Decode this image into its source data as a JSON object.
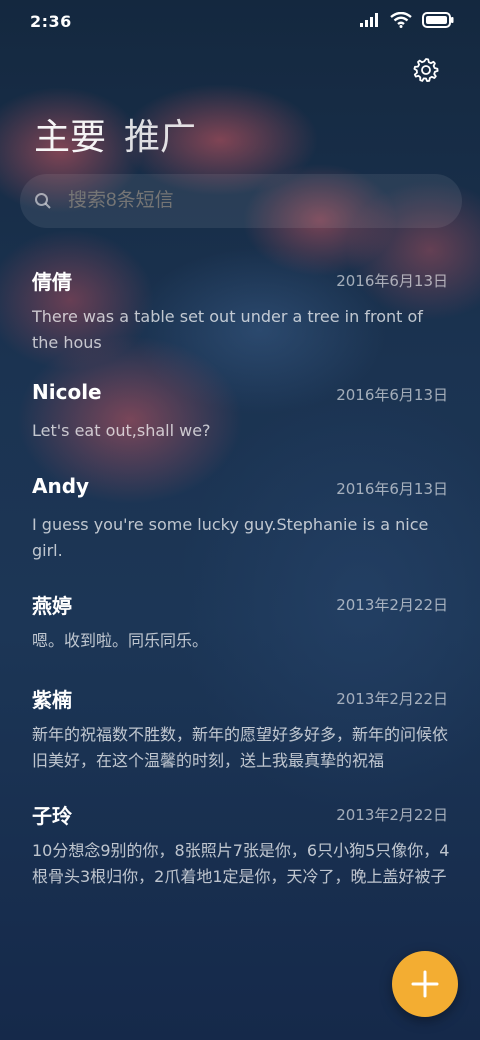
{
  "status_bar": {
    "time": "2:36",
    "icons": [
      "signal-icon",
      "wifi-icon",
      "battery-icon"
    ]
  },
  "header": {
    "settings_icon": "gear-icon",
    "tabs": [
      {
        "label": "主要",
        "active": true
      },
      {
        "label": "推广",
        "active": false
      }
    ]
  },
  "search": {
    "placeholder": "搜索8条短信",
    "icon": "search-icon"
  },
  "messages": [
    {
      "name": "倩倩",
      "date": "2016年6月13日",
      "preview": "There was a table set out under a tree in front of the hous"
    },
    {
      "name": "Nicole",
      "date": "2016年6月13日",
      "preview": "Let's eat out,shall we?"
    },
    {
      "name": "Andy",
      "date": "2016年6月13日",
      "preview": "I guess you're some lucky guy.Stephanie is a nice girl."
    },
    {
      "name": "燕婷",
      "date": "2013年2月22日",
      "preview": "嗯。收到啦。同乐同乐。"
    },
    {
      "name": "紫楠",
      "date": "2013年2月22日",
      "preview": "新年的祝福数不胜数，新年的愿望好多好多，新年的问候依旧美好，在这个温馨的时刻，送上我最真挚的祝福"
    },
    {
      "name": "子玲",
      "date": "2013年2月22日",
      "preview": "10分想念9别的你，8张照片7张是你，6只小狗5只像你，4根骨头3根归你，2爪着地1定是你，天冷了，晚上盖好被子"
    }
  ],
  "fab": {
    "icon": "plus-icon",
    "color": "#f3ad32"
  },
  "colors": {
    "accent": "#f3ad32",
    "background": "#1b3351"
  }
}
